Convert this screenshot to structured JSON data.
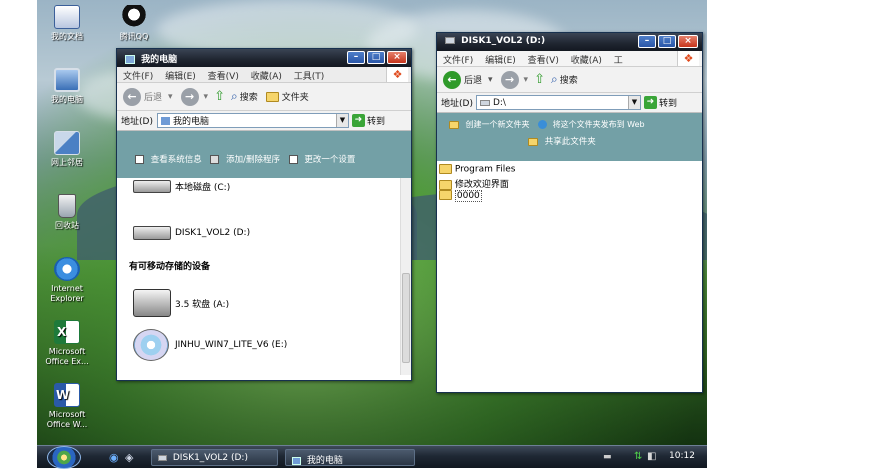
{
  "desktop": {
    "icons": [
      {
        "label": "我的文档",
        "icon": "my-documents-icon"
      },
      {
        "label": "腾讯QQ",
        "icon": "qq-icon"
      },
      {
        "label": "我的电脑",
        "icon": "my-computer-icon"
      },
      {
        "label": "网上邻居",
        "icon": "network-icon"
      },
      {
        "label": "回收站",
        "icon": "recycle-bin-icon"
      },
      {
        "label": "Internet Explorer",
        "icon": "ie-icon"
      },
      {
        "label": "Microsoft Office Ex...",
        "icon": "excel-icon"
      },
      {
        "label": "Microsoft Office W...",
        "icon": "word-icon"
      }
    ]
  },
  "win1": {
    "title": "我的电脑",
    "menu": [
      "文件(F)",
      "编辑(E)",
      "查看(V)",
      "收藏(A)",
      "工具(T)"
    ],
    "back": "后退",
    "search": "搜索",
    "folders": "文件夹",
    "address_label": "地址(D)",
    "address_value": "我的电脑",
    "go": "转到",
    "tasks": [
      "查看系统信息",
      "添加/删除程序",
      "更改一个设置"
    ],
    "drives": [
      "本地磁盘 (C:)",
      "DISK1_VOL2 (D:)"
    ],
    "removable_heading": "有可移动存储的设备",
    "removable": [
      "3.5 软盘 (A:)",
      "JINHU_WIN7_LITE_V6 (E:)"
    ]
  },
  "win2": {
    "title": "DISK1_VOL2 (D:)",
    "menu": [
      "文件(F)",
      "编辑(E)",
      "查看(V)",
      "收藏(A)",
      "工"
    ],
    "back": "后退",
    "search": "搜索",
    "address_label": "地址(D)",
    "address_value": "D:\\",
    "go": "转到",
    "tasks": [
      "创建一个新文件夹",
      "将这个文件夹发布到 Web",
      "共享此文件夹"
    ],
    "files": [
      "Program Files",
      "修改欢迎界面",
      "0000"
    ]
  },
  "taskbar": {
    "items": [
      "DISK1_VOL2 (D:)",
      "我的电脑"
    ],
    "clock": "10:12"
  },
  "colors": {
    "titlebar": "#1f2530",
    "taskpane": "#73a0a6",
    "taskbar": "#1f2834"
  }
}
